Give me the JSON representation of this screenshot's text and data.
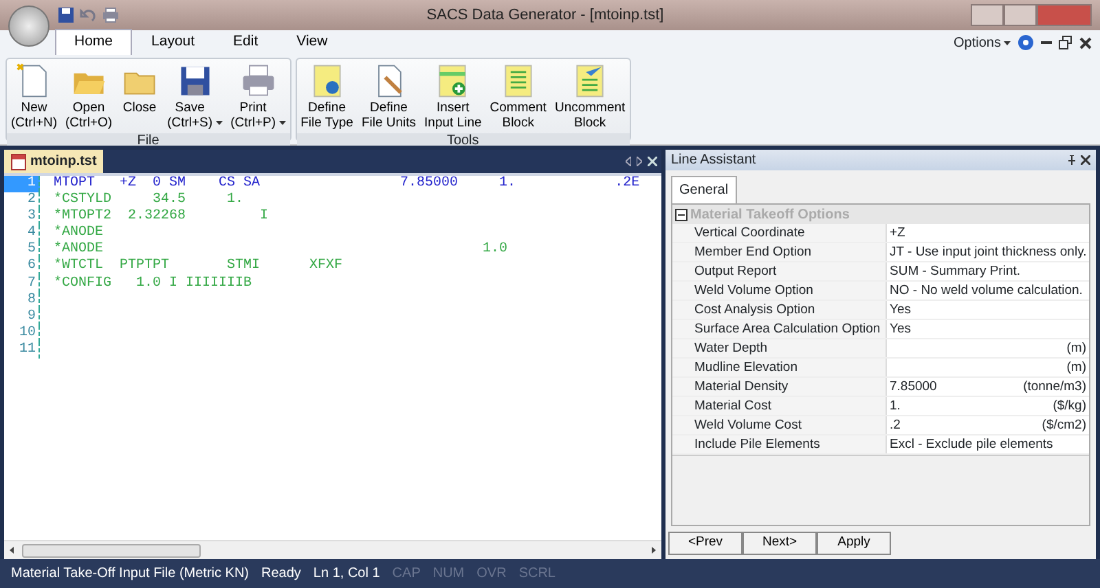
{
  "window": {
    "title": "SACS Data Generator - [mtoinp.tst]"
  },
  "ribbon_tabs": [
    {
      "label": "Home",
      "selected": true
    },
    {
      "label": "Layout",
      "selected": false
    },
    {
      "label": "Edit",
      "selected": false
    },
    {
      "label": "View",
      "selected": false
    }
  ],
  "options_menu": {
    "label": "Options"
  },
  "ribbon_groups": [
    {
      "title": "File",
      "buttons": [
        {
          "kind": "new",
          "label": "New\n(Ctrl+N)",
          "dropdown": false
        },
        {
          "kind": "open",
          "label": "Open\n(Ctrl+O)",
          "dropdown": false
        },
        {
          "kind": "close",
          "label": "Close",
          "dropdown": false
        },
        {
          "kind": "save",
          "label": "Save\n(Ctrl+S)",
          "dropdown": true
        },
        {
          "kind": "print",
          "label": "Print\n(Ctrl+P)",
          "dropdown": true
        }
      ]
    },
    {
      "title": "Tools",
      "buttons": [
        {
          "kind": "filetype",
          "label": "Define\nFile Type",
          "dropdown": false
        },
        {
          "kind": "fileunits",
          "label": "Define\nFile Units",
          "dropdown": false
        },
        {
          "kind": "insert",
          "label": "Insert\nInput Line",
          "dropdown": false
        },
        {
          "kind": "comment",
          "label": "Comment\nBlock",
          "dropdown": false
        },
        {
          "kind": "uncomment",
          "label": "Uncomment\nBlock",
          "dropdown": false
        }
      ]
    }
  ],
  "document_tab": {
    "label": "mtoinp.tst"
  },
  "editor_lines": [
    {
      "number": "1",
      "text": "MTOPT   +Z  0 SM    CS SA                 7.85000     1.            .2E",
      "kind": "command",
      "selected": true
    },
    {
      "number": "2",
      "text": "*CSTYLD     34.5     1.",
      "kind": "comment",
      "selected": false
    },
    {
      "number": "3",
      "text": "*MTOPT2  2.32268         I",
      "kind": "comment",
      "selected": false
    },
    {
      "number": "4",
      "text": "*ANODE",
      "kind": "comment",
      "selected": false
    },
    {
      "number": "5",
      "text": "*ANODE                                              1.0",
      "kind": "comment",
      "selected": false
    },
    {
      "number": "6",
      "text": "*WTCTL  PTPTPT       STMI      XFXF",
      "kind": "comment",
      "selected": false
    },
    {
      "number": "7",
      "text": "*CONFIG   1.0 I IIIIIIIB",
      "kind": "comment",
      "selected": false
    },
    {
      "number": "8",
      "selected": false
    },
    {
      "number": "9",
      "selected": false
    },
    {
      "number": "10",
      "selected": false
    },
    {
      "number": "11",
      "selected": false
    }
  ],
  "line_assistant": {
    "title": "Line Assistant",
    "tabs": [
      {
        "label": "General",
        "selected": true
      }
    ],
    "category": {
      "label": "Material Takeoff Options",
      "expanded": true
    },
    "properties": [
      {
        "name": "Vertical Coordinate",
        "value": "+Z"
      },
      {
        "name": "Member End Option",
        "value": "JT - Use input joint thickness only."
      },
      {
        "name": "Output Report",
        "value": "SUM - Summary Print."
      },
      {
        "name": "Weld Volume Option",
        "value": "NO - No weld volume calculation."
      },
      {
        "name": "Cost Analysis Option",
        "value": "Yes"
      },
      {
        "name": "Surface Area Calculation Option",
        "value": "Yes"
      },
      {
        "name": "Water Depth",
        "unit": "(m)"
      },
      {
        "name": "Mudline Elevation",
        "unit": "(m)"
      },
      {
        "name": "Material Density",
        "value": "7.85000",
        "unit": "(tonne/m3)"
      },
      {
        "name": "Material Cost",
        "value": "1.",
        "unit": "($/kg)"
      },
      {
        "name": "Weld Volume Cost",
        "value": ".2",
        "unit": "($/cm2)"
      },
      {
        "name": "Include Pile Elements",
        "value": "Excl - Exclude pile elements"
      }
    ],
    "buttons": [
      "<Prev",
      "Next>",
      "Apply"
    ]
  },
  "status_bar": [
    {
      "label": "Material Take-Off Input File (Metric KN)",
      "disabled": false
    },
    {
      "label": "Ready",
      "disabled": false
    },
    {
      "label": "Ln 1, Col 1",
      "disabled": false
    },
    {
      "label": "CAP",
      "disabled": true
    },
    {
      "label": "NUM",
      "disabled": true
    },
    {
      "label": "OVR",
      "disabled": true
    },
    {
      "label": "SCRL",
      "disabled": true
    }
  ]
}
